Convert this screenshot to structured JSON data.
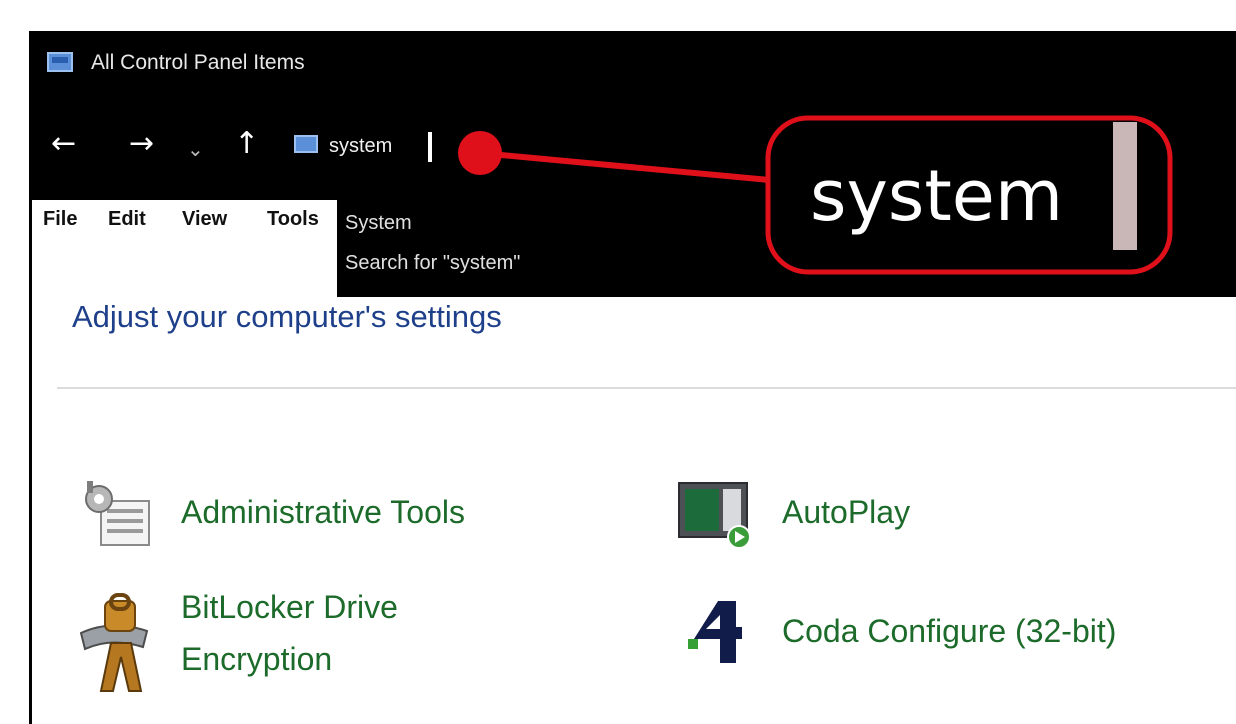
{
  "window": {
    "title": "All Control Panel Items"
  },
  "addressbar": {
    "back_glyph": "←",
    "forward_glyph": "→",
    "recent_glyph": "⌄",
    "up_glyph": "↑",
    "address_value": "system"
  },
  "menubar": {
    "items": [
      "File",
      "Edit",
      "View",
      "Tools"
    ]
  },
  "autocomplete": {
    "items": [
      "System",
      "Search for \"system\""
    ]
  },
  "main": {
    "heading": "Adjust your computer's settings",
    "items": [
      {
        "label": "Administrative Tools",
        "icon": "administrative-tools-icon"
      },
      {
        "label": "AutoPlay",
        "icon": "autoplay-icon"
      },
      {
        "label": "BitLocker Drive Encryption",
        "icon": "bitlocker-icon"
      },
      {
        "label": "Coda Configure (32-bit)",
        "icon": "coda-configure-icon"
      }
    ]
  },
  "callout": {
    "text": "system"
  },
  "colors": {
    "chrome_background": "#000000",
    "link_green": "#1c6b2a",
    "heading_blue": "#1e3f8a",
    "annotation_red": "#e0101a"
  }
}
